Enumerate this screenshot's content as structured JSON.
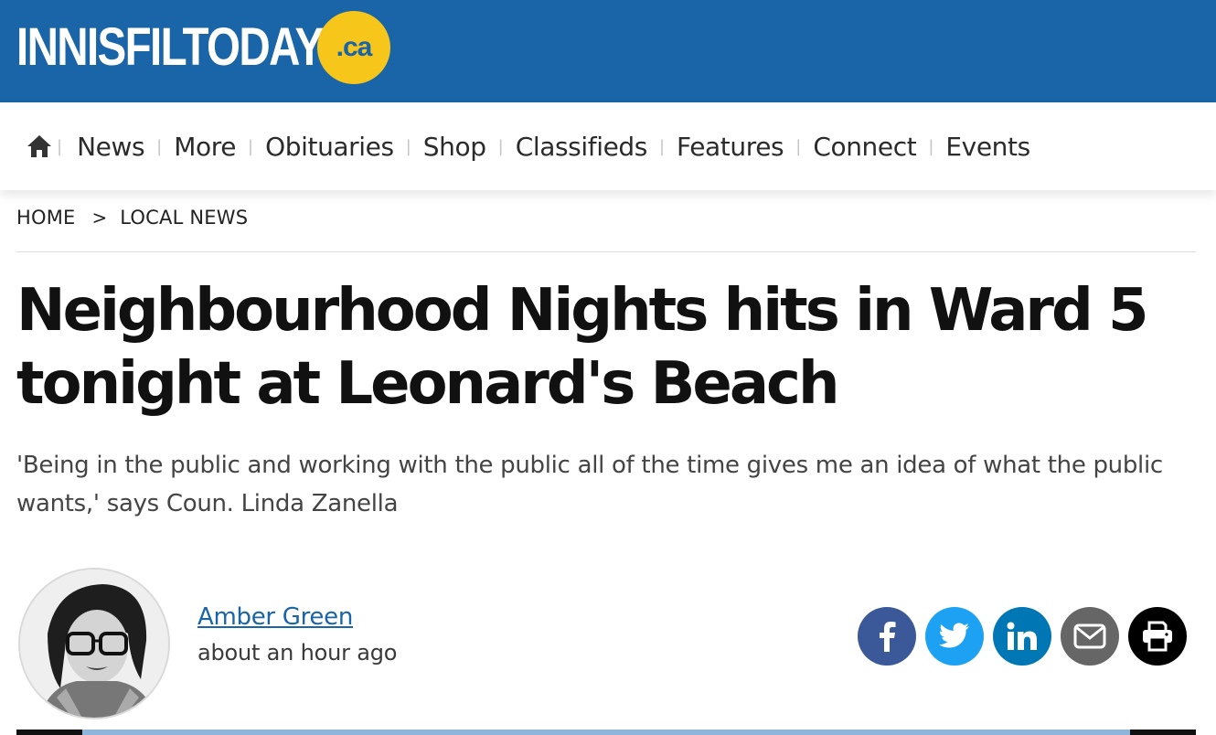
{
  "site": {
    "logo_text": "INNISFILTODAY",
    "logo_badge": ".ca",
    "brand_color": "#1a64a8",
    "badge_color": "#f7c61b"
  },
  "nav": {
    "home_icon": "home-icon",
    "items": [
      {
        "label": "News"
      },
      {
        "label": "More"
      },
      {
        "label": "Obituaries"
      },
      {
        "label": "Shop"
      },
      {
        "label": "Classifieds"
      },
      {
        "label": "Features"
      },
      {
        "label": "Connect"
      },
      {
        "label": "Events"
      }
    ],
    "separator": "|"
  },
  "breadcrumb": {
    "home": "HOME",
    "separator": ">",
    "section": "LOCAL NEWS"
  },
  "article": {
    "headline_line1": "Neighbourhood Nights hits in Ward 5",
    "headline_line2": "tonight at Leonard's Beach",
    "subhead": "'Being in the public and working with the public all of the time gives me an idea of what the public wants,' says Coun. Linda Zanella",
    "author": "Amber Green",
    "time": "about an hour ago"
  },
  "share": [
    {
      "icon": "facebook-icon",
      "color": "#3b5998"
    },
    {
      "icon": "twitter-icon",
      "color": "#1da1f2"
    },
    {
      "icon": "linkedin-icon",
      "color": "#0077b5"
    },
    {
      "icon": "email-icon",
      "color": "#666666"
    },
    {
      "icon": "print-icon",
      "color": "#000000"
    }
  ]
}
